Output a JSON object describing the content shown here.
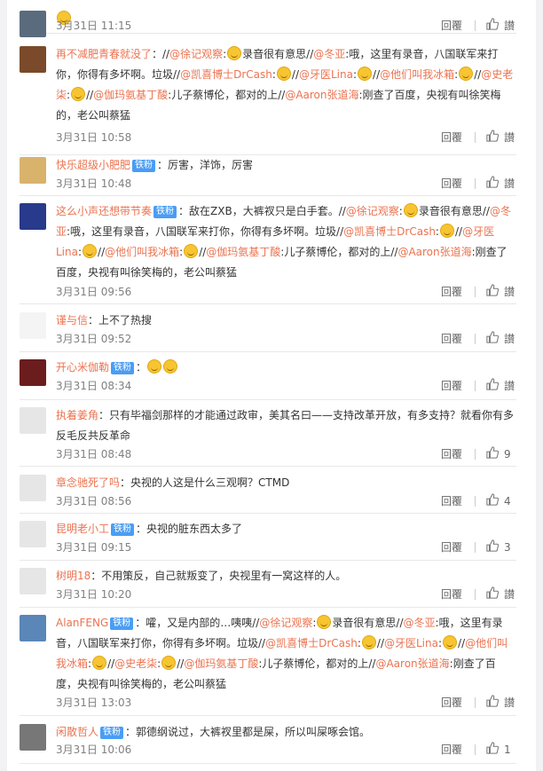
{
  "colors": {
    "link": "#eb7350",
    "badge": "#4a9df4",
    "meta": "#808080"
  },
  "comments": [
    {
      "name": "",
      "badge": "",
      "text": [
        {
          "t": "emoji"
        }
      ],
      "time": "3月31日 11:15",
      "reply": "回覆",
      "likes": "讃"
    },
    {
      "name": "再不减肥青春就没了",
      "badge": "",
      "text": [
        {
          "t": "text",
          "v": "：//"
        },
        {
          "t": "mention",
          "v": "@徐记观察"
        },
        {
          "t": "text",
          "v": ":"
        },
        {
          "t": "emoji"
        },
        {
          "t": "text",
          "v": "录音很有意思//"
        },
        {
          "t": "mention",
          "v": "@冬亚"
        },
        {
          "t": "text",
          "v": ":哦，这里有录音，八国联军来打你，你得有多坏啊。垃圾//"
        },
        {
          "t": "mention",
          "v": "@凯喜博士DrCash"
        },
        {
          "t": "text",
          "v": ":"
        },
        {
          "t": "emoji"
        },
        {
          "t": "text",
          "v": "//"
        },
        {
          "t": "mention",
          "v": "@牙医Lina"
        },
        {
          "t": "text",
          "v": ":"
        },
        {
          "t": "emoji"
        },
        {
          "t": "text",
          "v": "//"
        },
        {
          "t": "mention",
          "v": "@他们叫我冰箱"
        },
        {
          "t": "text",
          "v": ":"
        },
        {
          "t": "emoji"
        },
        {
          "t": "text",
          "v": "//"
        },
        {
          "t": "mention",
          "v": "@史老柒"
        },
        {
          "t": "text",
          "v": ":"
        },
        {
          "t": "emoji"
        },
        {
          "t": "text",
          "v": "//"
        },
        {
          "t": "mention",
          "v": "@伽玛氨基丁酸"
        },
        {
          "t": "text",
          "v": ":儿子蔡博伦，都对的上//"
        },
        {
          "t": "mention",
          "v": "@Aaron张道海"
        },
        {
          "t": "text",
          "v": ":刚查了百度，央视有叫徐笑梅的，老公叫蔡猛"
        }
      ],
      "time": "3月31日 10:58",
      "reply": "回覆",
      "likes": "讃"
    },
    {
      "name": "快乐超级小肥肥",
      "badge": "铁粉",
      "text": [
        {
          "t": "text",
          "v": "：厉害，洋饰，厉害"
        }
      ],
      "time": "3月31日 10:48",
      "reply": "回覆",
      "likes": "讃"
    },
    {
      "name": "这么小声还想带节奏",
      "badge": "铁粉",
      "text": [
        {
          "t": "text",
          "v": "：敌在ZXB，大裤衩只是白手套。//"
        },
        {
          "t": "mention",
          "v": "@徐记观察"
        },
        {
          "t": "text",
          "v": ":"
        },
        {
          "t": "emoji"
        },
        {
          "t": "text",
          "v": "录音很有意思//"
        },
        {
          "t": "mention",
          "v": "@冬亚"
        },
        {
          "t": "text",
          "v": ":哦，这里有录音，八国联军来打你，你得有多坏啊。垃圾//"
        },
        {
          "t": "mention",
          "v": "@凯喜博士DrCash"
        },
        {
          "t": "text",
          "v": ":"
        },
        {
          "t": "emoji"
        },
        {
          "t": "text",
          "v": "//"
        },
        {
          "t": "mention",
          "v": "@牙医Lina"
        },
        {
          "t": "text",
          "v": ":"
        },
        {
          "t": "emoji"
        },
        {
          "t": "text",
          "v": "//"
        },
        {
          "t": "mention",
          "v": "@他们叫我冰箱"
        },
        {
          "t": "text",
          "v": ":"
        },
        {
          "t": "emoji"
        },
        {
          "t": "text",
          "v": "//"
        },
        {
          "t": "mention",
          "v": "@伽玛氨基丁酸"
        },
        {
          "t": "text",
          "v": ":儿子蔡博伦，都对的上//"
        },
        {
          "t": "mention",
          "v": "@Aaron张道海"
        },
        {
          "t": "text",
          "v": ":刚查了百度，央视有叫徐笑梅的，老公叫蔡猛"
        }
      ],
      "time": "3月31日 09:56",
      "reply": "回覆",
      "likes": "讃"
    },
    {
      "name": "谨与信",
      "badge": "",
      "text": [
        {
          "t": "text",
          "v": "：上不了热搜"
        }
      ],
      "time": "3月31日 09:52",
      "reply": "回覆",
      "likes": "讃"
    },
    {
      "name": "开心米伽勒",
      "badge": "铁粉",
      "text": [
        {
          "t": "text",
          "v": "："
        },
        {
          "t": "emoji"
        },
        {
          "t": "emoji"
        }
      ],
      "time": "3月31日 08:34",
      "reply": "回覆",
      "likes": "讃"
    },
    {
      "name": "执着姜角",
      "badge": "",
      "text": [
        {
          "t": "text",
          "v": "：只有毕福剑那样的才能通过政审，美其名曰——支持改革开放，有多支持？就看你有多反毛反共反革命"
        }
      ],
      "time": "3月31日 08:48",
      "reply": "回覆",
      "likes": "9"
    },
    {
      "name": "章念驰死了吗",
      "badge": "",
      "text": [
        {
          "t": "text",
          "v": "：央视的人这是什么三观啊？CTMD"
        }
      ],
      "time": "3月31日 08:56",
      "reply": "回覆",
      "likes": "4"
    },
    {
      "name": "昆明老小工",
      "badge": "铁粉",
      "text": [
        {
          "t": "text",
          "v": "：央视的脏东西太多了"
        }
      ],
      "time": "3月31日 09:15",
      "reply": "回覆",
      "likes": "3"
    },
    {
      "name": "树明18",
      "badge": "",
      "text": [
        {
          "t": "text",
          "v": "：不用策反，自己就叛变了，央视里有一窝这样的人。"
        }
      ],
      "time": "3月31日 10:20",
      "reply": "回覆",
      "likes": "讃"
    },
    {
      "name": "AlanFENG",
      "badge": "铁粉",
      "text": [
        {
          "t": "text",
          "v": "：嚯，又是内部的…咦咦//"
        },
        {
          "t": "mention",
          "v": "@徐记观察"
        },
        {
          "t": "text",
          "v": ":"
        },
        {
          "t": "emoji"
        },
        {
          "t": "text",
          "v": "录音很有意思//"
        },
        {
          "t": "mention",
          "v": "@冬亚"
        },
        {
          "t": "text",
          "v": ":哦，这里有录音，八国联军来打你，你得有多坏啊。垃圾//"
        },
        {
          "t": "mention",
          "v": "@凯喜博士DrCash"
        },
        {
          "t": "text",
          "v": ":"
        },
        {
          "t": "emoji"
        },
        {
          "t": "text",
          "v": "//"
        },
        {
          "t": "mention",
          "v": "@牙医Lina"
        },
        {
          "t": "text",
          "v": ":"
        },
        {
          "t": "emoji"
        },
        {
          "t": "text",
          "v": "//"
        },
        {
          "t": "mention",
          "v": "@他们叫我冰箱"
        },
        {
          "t": "text",
          "v": ":"
        },
        {
          "t": "emoji"
        },
        {
          "t": "text",
          "v": "//"
        },
        {
          "t": "mention",
          "v": "@史老柒"
        },
        {
          "t": "text",
          "v": ":"
        },
        {
          "t": "emoji"
        },
        {
          "t": "text",
          "v": "//"
        },
        {
          "t": "mention",
          "v": "@伽玛氨基丁酸"
        },
        {
          "t": "text",
          "v": ":儿子蔡博伦，都对的上//"
        },
        {
          "t": "mention",
          "v": "@Aaron张道海"
        },
        {
          "t": "text",
          "v": ":刚查了百度，央视有叫徐笑梅的，老公叫蔡猛"
        }
      ],
      "time": "3月31日 13:03",
      "reply": "回覆",
      "likes": "讃"
    },
    {
      "name": "闲散哲人",
      "badge": "铁粉",
      "text": [
        {
          "t": "text",
          "v": "：郭德纲说过，大裤衩里都是屎，所以叫屎啄会馆。"
        }
      ],
      "time": "3月31日 10:06",
      "reply": "回覆",
      "likes": "1"
    }
  ]
}
